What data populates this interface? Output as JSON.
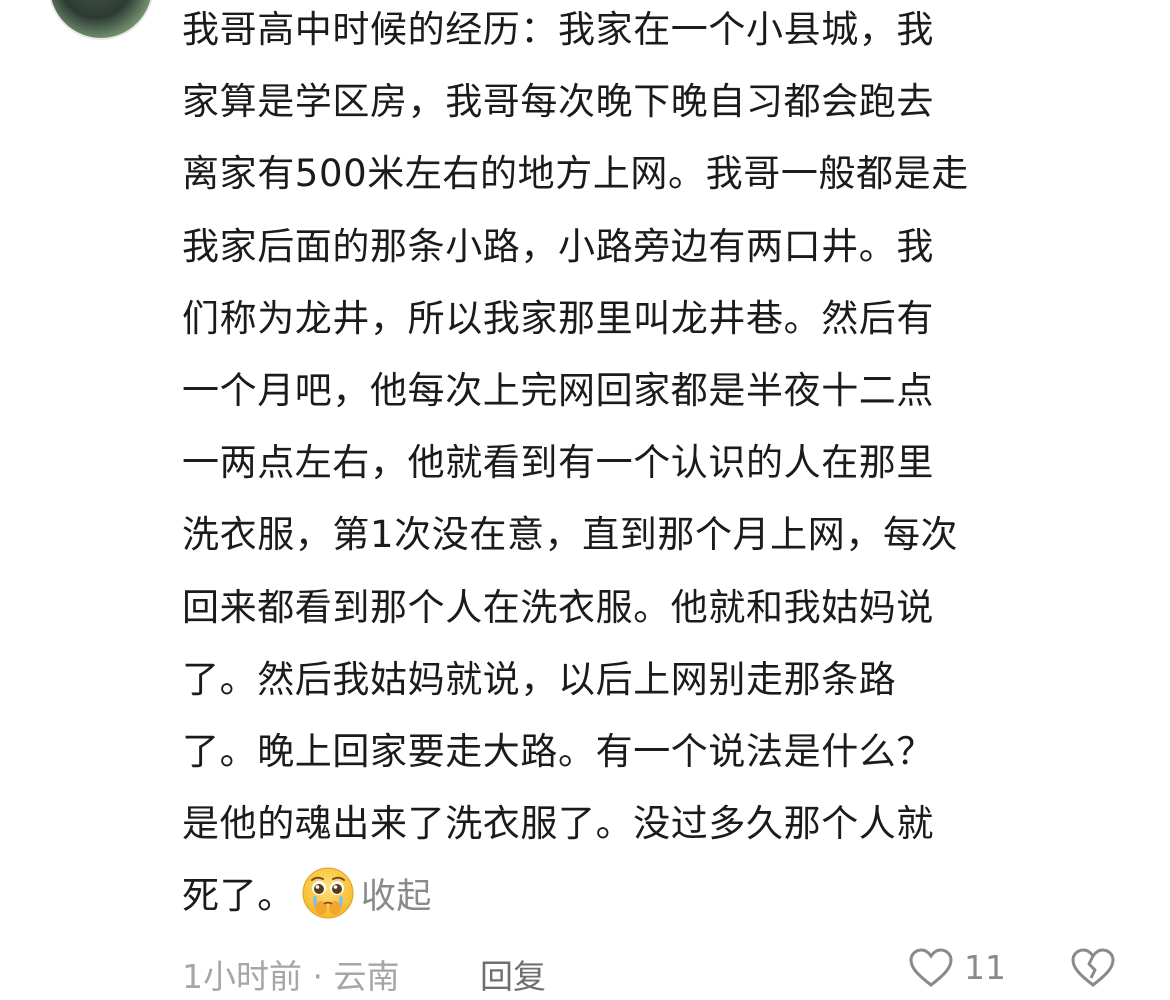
{
  "comment": {
    "lines": [
      "我哥高中时候的经历：我家在一个小县城，我",
      "家算是学区房，我哥每次晚下晚自习都会跑去",
      "离家有500米左右的地方上网。我哥一般都是走",
      "我家后面的那条小路，小路旁边有两口井。我",
      "们称为龙井，所以我家那里叫龙井巷。然后有",
      "一个月吧，他每次上完网回家都是半夜十二点",
      "一两点左右，他就看到有一个认识的人在那里",
      "洗衣服，第1次没在意，直到那个月上网，每次",
      "回来都看到那个人在洗衣服。他就和我姑妈说",
      "了。然后我姑妈就说，以后上网别走那条路",
      "了。晚上回家要走大路。有一个说法是什么？",
      "是他的魂出来了洗衣服了。没过多久那个人就"
    ],
    "last_line": "死了。",
    "emoji": "pleading-crying-face-emoji",
    "collapse_label": "收起"
  },
  "meta": {
    "time_location": "1小时前 · 云南",
    "reply_label": "回复",
    "like_count": "11",
    "like_icon": "heart-outline-icon",
    "dislike_icon": "broken-heart-outline-icon"
  },
  "colors": {
    "text": "#1b1b1b",
    "muted": "#8a8a8a",
    "meta": "#a6a6a6"
  }
}
